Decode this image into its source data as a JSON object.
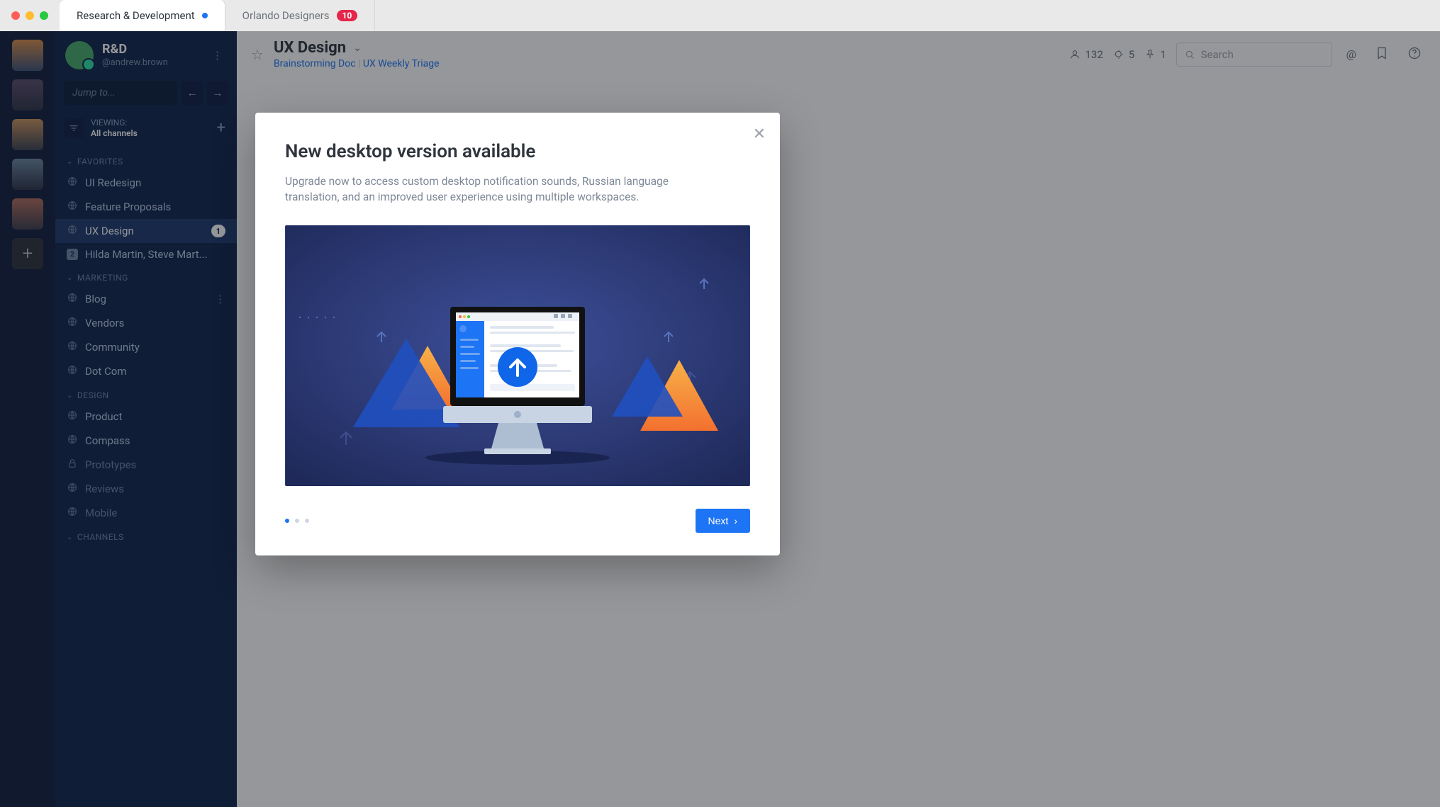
{
  "tabs": [
    {
      "label": "Research & Development",
      "active": true,
      "indicator": "dot"
    },
    {
      "label": "Orlando Designers",
      "active": false,
      "badge": "10"
    }
  ],
  "sidebar": {
    "team": "R&D",
    "user": "@andrew.brown",
    "jump_placeholder": "Jump to...",
    "filter": {
      "viewing": "VIEWING:",
      "value": "All channels"
    },
    "sections": [
      {
        "title": "FAVORITES",
        "items": [
          {
            "icon": "globe",
            "label": "UI Redesign"
          },
          {
            "icon": "globe",
            "label": "Feature Proposals"
          },
          {
            "icon": "globe",
            "label": "UX Design",
            "active": true,
            "pill": "1"
          },
          {
            "icon": "count",
            "count": "2",
            "label": "Hilda Martin, Steve Mart..."
          }
        ]
      },
      {
        "title": "MARKETING",
        "items": [
          {
            "icon": "globe",
            "label": "Blog",
            "kebab": true
          },
          {
            "icon": "globe",
            "label": "Vendors"
          },
          {
            "icon": "globe",
            "label": "Community"
          },
          {
            "icon": "globe",
            "label": "Dot Com"
          }
        ]
      },
      {
        "title": "DESIGN",
        "items": [
          {
            "icon": "globe",
            "label": "Product"
          },
          {
            "icon": "globe",
            "label": "Compass"
          },
          {
            "icon": "lock",
            "label": "Prototypes",
            "muted": true
          },
          {
            "icon": "globe",
            "label": "Reviews",
            "muted": true
          },
          {
            "icon": "globe",
            "label": "Mobile",
            "muted": true
          }
        ]
      },
      {
        "title": "CHANNELS",
        "items": []
      }
    ]
  },
  "channel": {
    "title": "UX Design",
    "links": [
      "Brainstorming Doc",
      "UX Weekly Triage"
    ],
    "members": "132",
    "discussions": "5",
    "pins": "1",
    "search_placeholder": "Search"
  },
  "modal": {
    "title": "New desktop version available",
    "desc": "Upgrade now to access custom desktop notification sounds, Russian language translation, and an improved user experience using multiple workspaces.",
    "next_label": "Next"
  },
  "colors": {
    "accent": "#1d74f5",
    "danger": "#e4264a"
  }
}
